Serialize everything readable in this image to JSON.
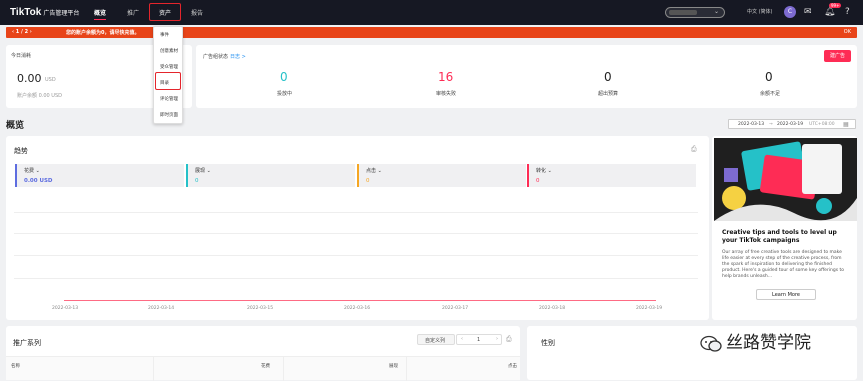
{
  "topbar": {
    "logo": "TikTok",
    "logo_sub": "广告管理平台",
    "nav": [
      "概览",
      "推广",
      "资产",
      "报告"
    ],
    "lang": "中文 (简体)",
    "avatar": "C",
    "badge": "99+"
  },
  "banner": {
    "pager": "‹   1  /  2   ›",
    "message": "您的账户余额为0，请尽快充值。",
    "ok": "OK"
  },
  "dropdown": [
    "事件",
    "创意素材",
    "受众管理",
    "目录",
    "评论管理",
    "即时页面"
  ],
  "balance": {
    "label": "今日消耗",
    "amount": "0.00",
    "unit": "USD",
    "account_balance": "账户余额 0.00 USD"
  },
  "status": {
    "label": "广告组状态",
    "link": "日志 >",
    "create_button": "建广告",
    "items": [
      {
        "value": "0",
        "label": "投放中",
        "color": "#25c1c8"
      },
      {
        "value": "16",
        "label": "审核失败",
        "color": "#fe2c55"
      },
      {
        "value": "0",
        "label": "超出预算",
        "color": "#222222"
      },
      {
        "value": "0",
        "label": "余额不足",
        "color": "#222222"
      }
    ]
  },
  "overview": {
    "title": "概览",
    "date_from": "2022-03-13",
    "date_to": "2022-03-19",
    "timezone": "UTC+08:00"
  },
  "trend": {
    "title": "趋势",
    "metrics": [
      {
        "name": "花费",
        "value": "0.00 USD",
        "color": "#5e6de0"
      },
      {
        "name": "展现",
        "value": "0",
        "color": "#25c1c8"
      },
      {
        "name": "点击",
        "value": "0",
        "color": "#f5a623"
      },
      {
        "name": "转化",
        "value": "0",
        "color": "#fe2c55"
      }
    ],
    "x_ticks": [
      "2022-03-13",
      "2022-03-14",
      "2022-03-15",
      "2022-03-16",
      "2022-03-17",
      "2022-03-18",
      "2022-03-19"
    ]
  },
  "ad_panel": {
    "title": "Creative tips and tools to level up your TikTok campaigns",
    "text": "Our array of free creative tools are designed to make life easier at every step of the creative process, from the spark of inspiration to delivering the finished product. Here's a guided tour of some key offerings to help brands unleash...",
    "button": "Learn More"
  },
  "campaign": {
    "title": "推广系列",
    "custom_cols": "自定义列",
    "page": "1",
    "columns": [
      "名称",
      "花费",
      "展现",
      "点击"
    ]
  },
  "gender": {
    "title": "性别"
  },
  "watermark": "丝路赞学院",
  "colors": {
    "accent": "#fe2c55",
    "banner": "#e84419",
    "highlight": "#e4252c"
  }
}
